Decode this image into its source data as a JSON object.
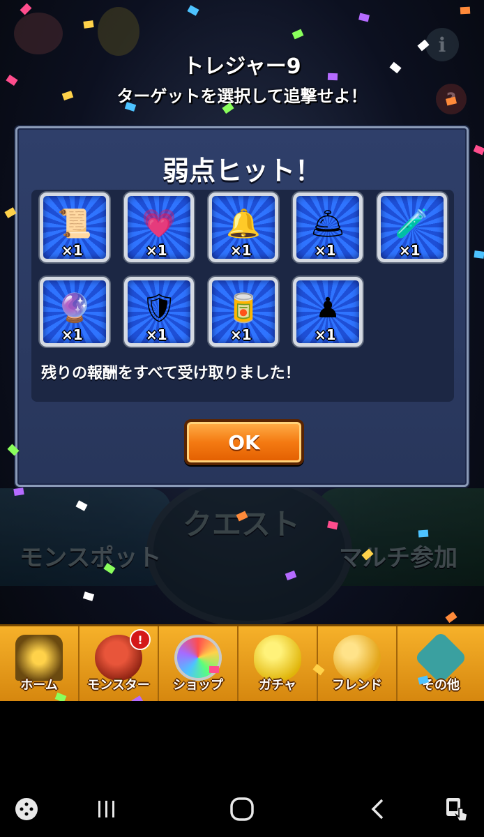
{
  "header": {
    "title": "トレジャー9",
    "subtitle": "ターゲットを選択して追撃せよ！"
  },
  "dialog": {
    "title": "弱点ヒット！",
    "items": [
      {
        "icon": "scroll-icon",
        "art": "📜",
        "quantity": "×1"
      },
      {
        "icon": "heart-potion-icon",
        "art": "💗",
        "quantity": "×1"
      },
      {
        "icon": "gold-bell-icon",
        "art": "🔔",
        "quantity": "×1"
      },
      {
        "icon": "silver-bell-icon",
        "art": "🛎",
        "quantity": "×1"
      },
      {
        "icon": "sprout-bottle-icon",
        "art": "🧪",
        "quantity": "×1"
      },
      {
        "icon": "crystal-orb-icon",
        "art": "🔮",
        "quantity": "×1"
      },
      {
        "icon": "silver-crest-icon",
        "art": "🛡",
        "quantity": "×1"
      },
      {
        "icon": "fire-can-icon",
        "art": "🥫",
        "quantity": "×1"
      },
      {
        "icon": "golden-pawn-icon",
        "art": "♟",
        "quantity": "×1"
      }
    ],
    "message": "残りの報酬をすべて受け取りました！",
    "ok_label": "OK"
  },
  "background": {
    "left_button": "モンスポット",
    "center_button": "クエスト",
    "right_button": "マルチ参加",
    "info_icon": "i",
    "help_icon": "?"
  },
  "menu": {
    "items": [
      {
        "label": "ホーム",
        "icon": "home-gate-icon",
        "color": "#6b4a10"
      },
      {
        "label": "モンスター",
        "icon": "monster-icon",
        "color": "#b3341f",
        "badge": "!"
      },
      {
        "label": "ショップ",
        "icon": "orb-icon",
        "color": "#7a6fa5"
      },
      {
        "label": "ガチャ",
        "icon": "egg-icon",
        "color": "#f2d21a"
      },
      {
        "label": "フレンド",
        "icon": "friends-icon",
        "color": "#f1c232"
      },
      {
        "label": "その他",
        "icon": "more-icon",
        "color": "#2d8a8a"
      }
    ]
  },
  "navbar": {
    "items": [
      "game-tools-icon",
      "recent-apps-icon",
      "home-icon",
      "back-icon",
      "screen-touch-icon"
    ]
  }
}
